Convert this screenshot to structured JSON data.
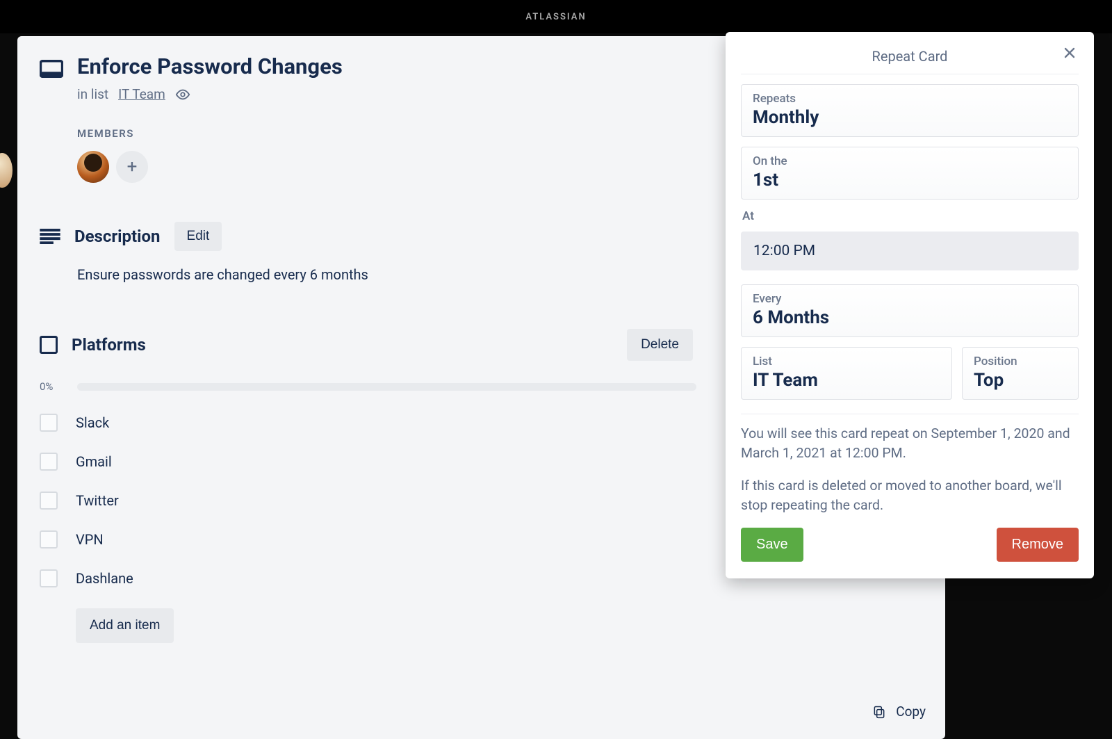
{
  "header": {
    "brand": "ATLASSIAN"
  },
  "card": {
    "title": "Enforce Password Changes",
    "in_list_prefix": "in list",
    "list_name": "IT Team",
    "members_label": "MEMBERS",
    "description": {
      "heading": "Description",
      "edit_label": "Edit",
      "text": "Ensure passwords are changed every 6 months"
    },
    "checklist": {
      "title": "Platforms",
      "delete_label": "Delete",
      "progress_percent": "0%",
      "items": [
        "Slack",
        "Gmail",
        "Twitter",
        "VPN",
        "Dashlane"
      ],
      "add_item_label": "Add an item"
    }
  },
  "side": {
    "copy_label": "Copy"
  },
  "popover": {
    "title": "Repeat Card",
    "repeats": {
      "label": "Repeats",
      "value": "Monthly"
    },
    "on_the": {
      "label": "On the",
      "value": "1st"
    },
    "at_label": "At",
    "time_value": "12:00 PM",
    "every": {
      "label": "Every",
      "value": "6 Months"
    },
    "list": {
      "label": "List",
      "value": "IT Team"
    },
    "position": {
      "label": "Position",
      "value": "Top"
    },
    "info1": "You will see this card repeat on September 1, 2020 and March 1, 2021 at 12:00 PM.",
    "info2": "If this card is deleted or moved to another board, we'll stop repeating the card.",
    "save_label": "Save",
    "remove_label": "Remove"
  }
}
